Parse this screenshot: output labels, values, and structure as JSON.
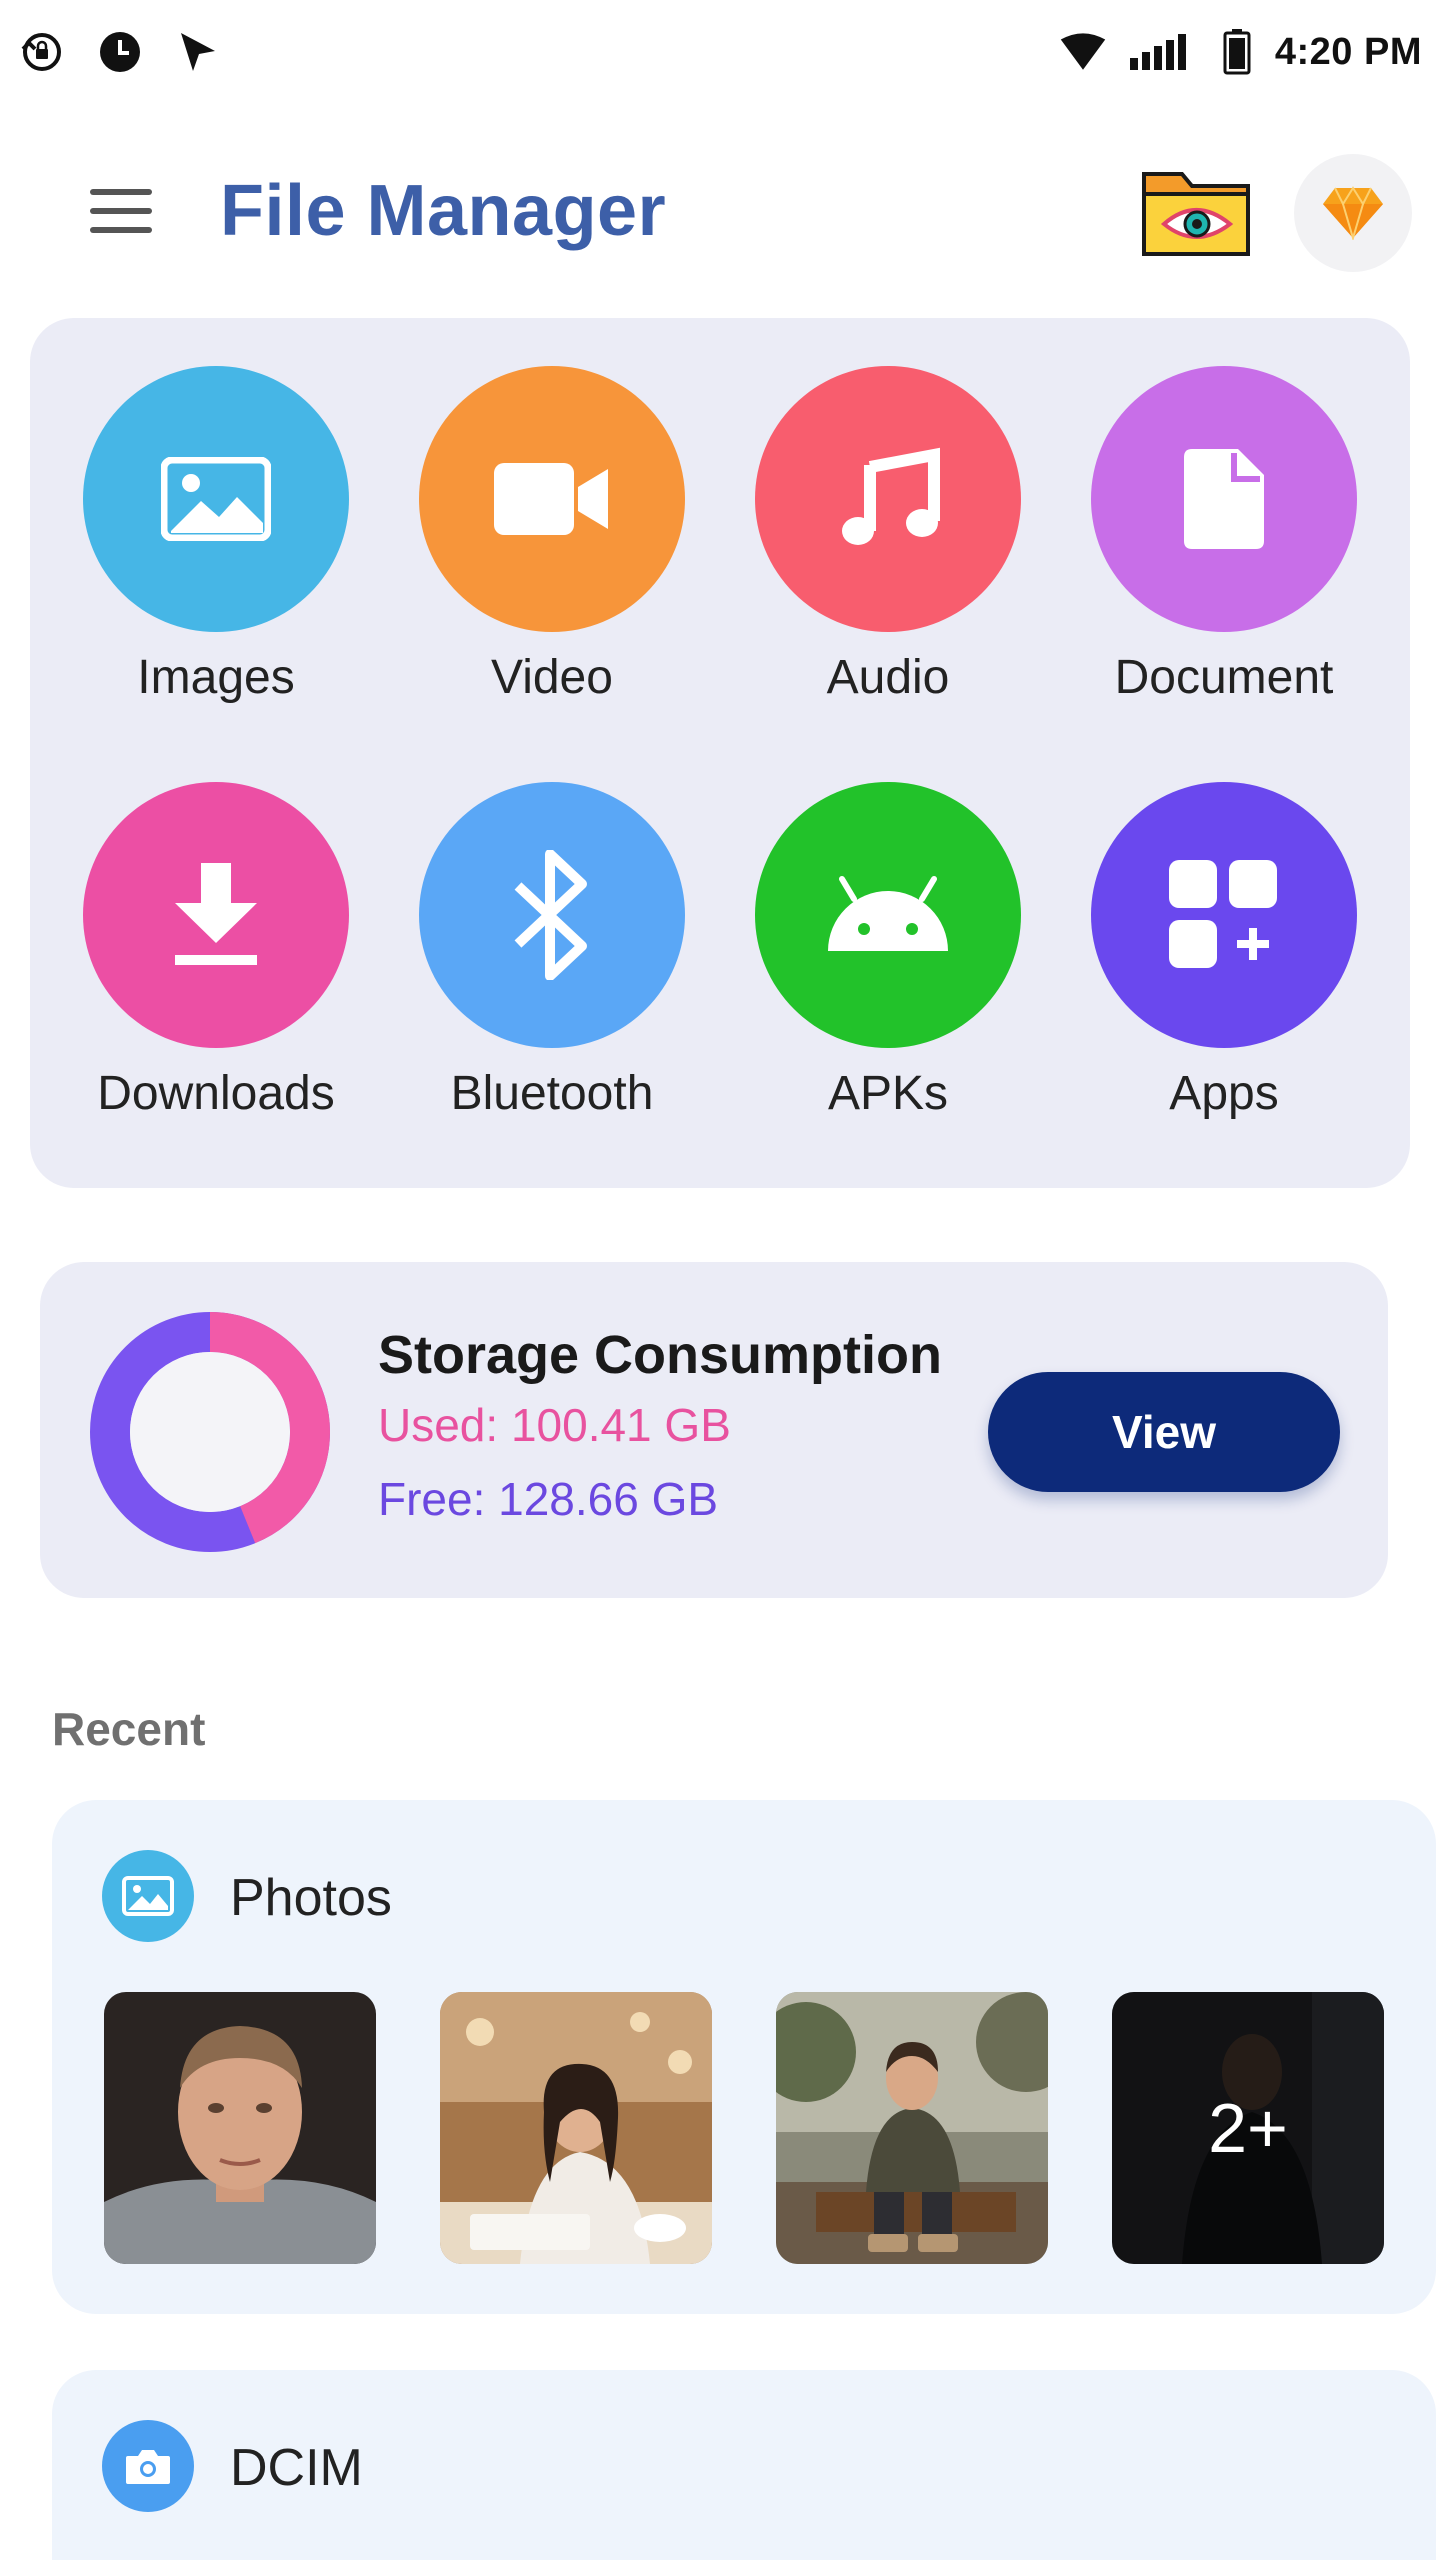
{
  "status_bar": {
    "time": "4:20 PM"
  },
  "header": {
    "title": "File Manager"
  },
  "categories": [
    {
      "label": "Images",
      "color": "#46b6e6",
      "icon": "image-icon"
    },
    {
      "label": "Video",
      "color": "#f7953a",
      "icon": "video-icon"
    },
    {
      "label": "Audio",
      "color": "#f85d6e",
      "icon": "music-note-icon"
    },
    {
      "label": "Document",
      "color": "#c86ee8",
      "icon": "document-icon"
    },
    {
      "label": "Downloads",
      "color": "#ec4fa4",
      "icon": "download-icon"
    },
    {
      "label": "Bluetooth",
      "color": "#5aa7f6",
      "icon": "bluetooth-icon"
    },
    {
      "label": "APKs",
      "color": "#22c22a",
      "icon": "android-icon"
    },
    {
      "label": "Apps",
      "color": "#6a48ee",
      "icon": "apps-grid-icon"
    }
  ],
  "storage": {
    "title": "Storage Consumption",
    "used_text": "Used: 100.41 GB",
    "free_text": "Free: 128.66 GB",
    "used_gb": 100.41,
    "free_gb": 128.66,
    "used_color": "#f25aa8",
    "free_color": "#7a54f0",
    "view_label": "View"
  },
  "recent": {
    "label": "Recent",
    "photos": {
      "title": "Photos",
      "more_label": "2+"
    },
    "dcim": {
      "title": "DCIM"
    }
  }
}
